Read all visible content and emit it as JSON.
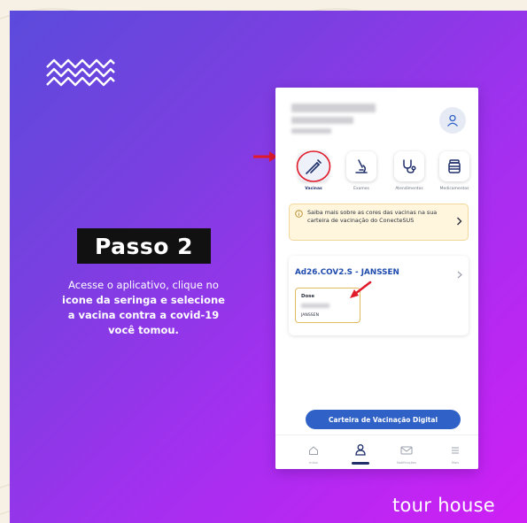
{
  "step": {
    "title": "Passo 2",
    "line1": "Acesse o aplicativo, clique no",
    "line2": "icone da seringa e selecione",
    "line3": "a vacina contra a covid-19",
    "line4": "você tomou."
  },
  "app": {
    "tabs": [
      {
        "label": "Vacinas",
        "icon": "syringe-icon",
        "active": true
      },
      {
        "label": "Exames",
        "icon": "microscope-icon",
        "active": false
      },
      {
        "label": "Atendimentos",
        "icon": "stethoscope-icon",
        "active": false
      },
      {
        "label": "Medicamentos",
        "icon": "pill-bottle-icon",
        "active": false
      }
    ],
    "info_banner": "Saiba mais sobre as cores das vacinas na sua carteira de vacinação do ConecteSUS",
    "vaccine": {
      "name": "Ad26.COV2.S - JANSSEN",
      "dose_label": "Dose",
      "dose_manufacturer": "JANSSEN"
    },
    "primary_button": "Carteira de Vacinação Digital",
    "bottom_nav": [
      {
        "label": "Início",
        "icon": "home-icon"
      },
      {
        "label": "",
        "icon": "person-icon",
        "active": true
      },
      {
        "label": "Notificações",
        "icon": "mail-icon"
      },
      {
        "label": "Mais",
        "icon": "menu-icon"
      }
    ]
  },
  "brand": "tour house",
  "colors": {
    "gradient_start": "#5b4bdc",
    "gradient_end": "#cf1ff5",
    "accent_blue": "#2f61c7",
    "annotation_red": "#e21b2a",
    "dose_border": "#e2bb5e"
  }
}
